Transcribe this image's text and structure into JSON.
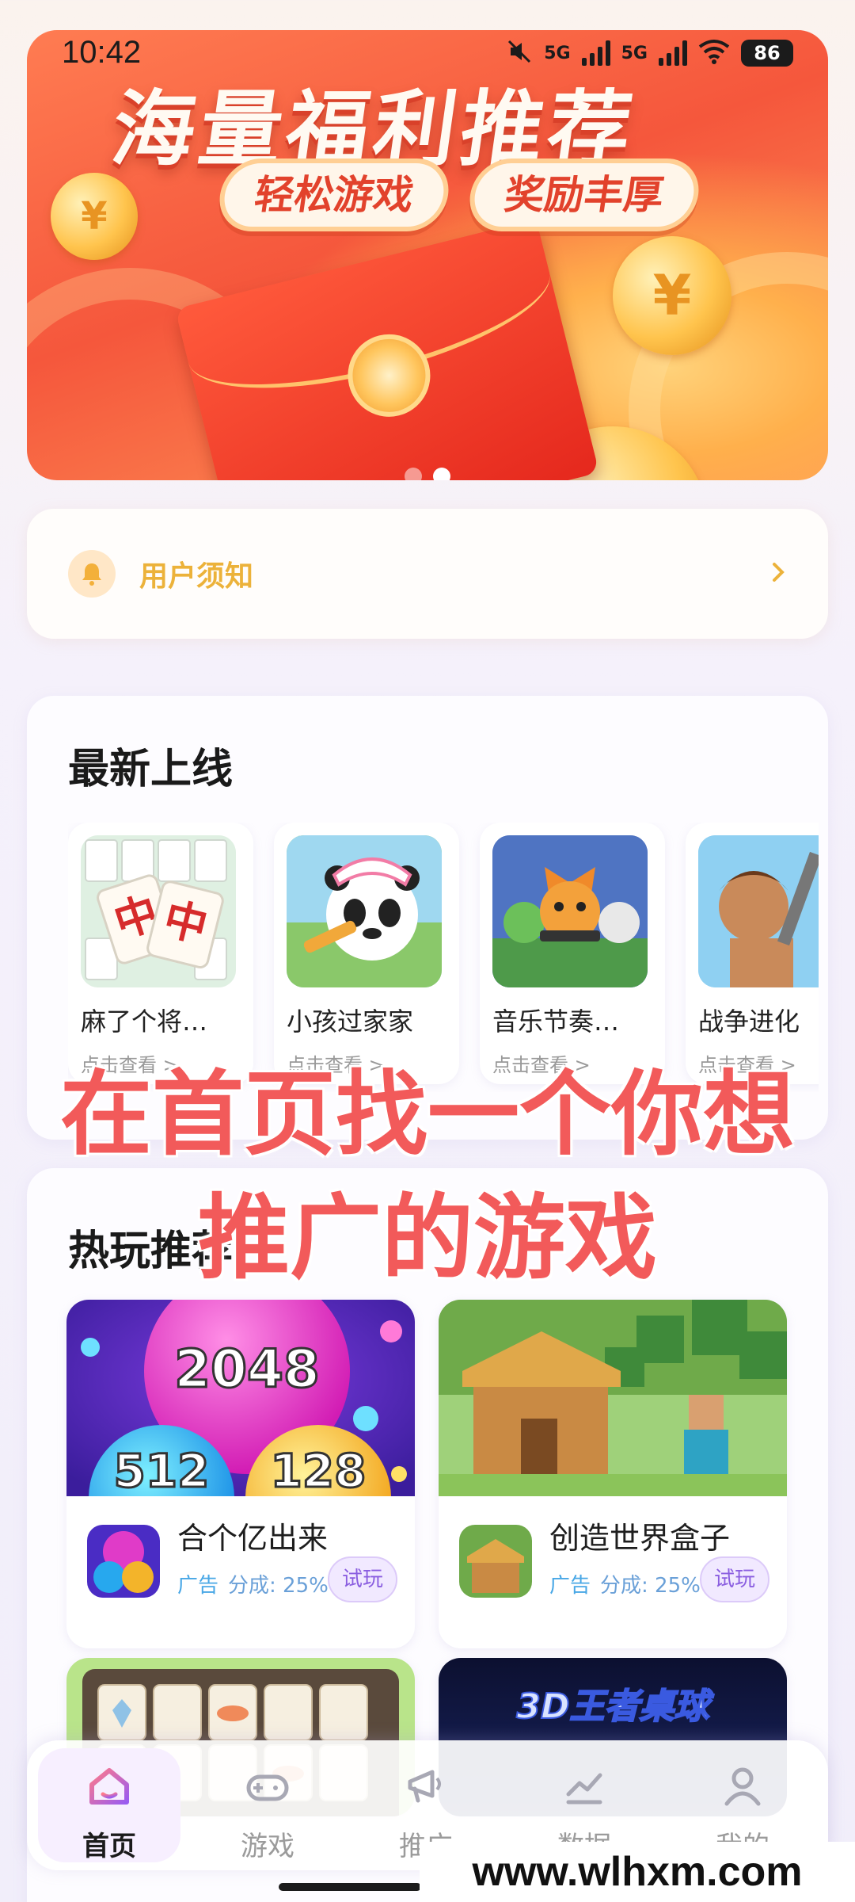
{
  "status_bar": {
    "time": "10:42",
    "network_1": "5G",
    "network_2": "5G",
    "battery": "86"
  },
  "banner": {
    "title": "海量福利推荐",
    "pill_left": "轻松游戏",
    "pill_right": "奖励丰厚",
    "coin_symbol": "¥",
    "page_count": 2,
    "active_page": 2
  },
  "notice": {
    "label": "用户须知",
    "icon": "bell-icon",
    "arrow_icon": "chevron-right-icon"
  },
  "new_release": {
    "title": "最新上线",
    "items": [
      {
        "name": "麻了个将…",
        "sub": "点击查看 >"
      },
      {
        "name": "小孩过家家",
        "sub": "点击查看 >"
      },
      {
        "name": "音乐节奏…",
        "sub": "点击查看 >"
      },
      {
        "name": "战争进化",
        "sub": "点击查看 >"
      }
    ]
  },
  "hot": {
    "title": "热玩推荐",
    "items": [
      {
        "name": "合个亿出来",
        "ad": "广告",
        "share": "分成: 25%",
        "try": "试玩",
        "cover_text_1": "2048",
        "cover_text_2": "512",
        "cover_text_3": "128"
      },
      {
        "name": "创造世界盒子",
        "ad": "广告",
        "share": "分成: 25%",
        "try": "试玩"
      },
      {
        "name": "",
        "ad": "",
        "share": "",
        "try": ""
      },
      {
        "name": "",
        "ad": "",
        "share": "",
        "try": "",
        "cover_text_1": "3D王者桌球"
      }
    ]
  },
  "overlay_caption": {
    "line1": "在首页找一个你想",
    "line2": "推广的游戏"
  },
  "bottom_nav": [
    {
      "label": "首页",
      "icon": "home-icon",
      "active": true
    },
    {
      "label": "游戏",
      "icon": "gamepad-icon",
      "active": false
    },
    {
      "label": "推广",
      "icon": "megaphone-icon",
      "active": false
    },
    {
      "label": "数据",
      "icon": "chart-icon",
      "active": false
    },
    {
      "label": "我的",
      "icon": "user-icon",
      "active": false
    }
  ],
  "watermark": "www.wlhxm.com",
  "colors": {
    "accent_orange": "#ecb23a",
    "overlay_red": "#f25a5a",
    "try_purple": "#8a5ee0",
    "ad_blue": "#48a7e6"
  }
}
